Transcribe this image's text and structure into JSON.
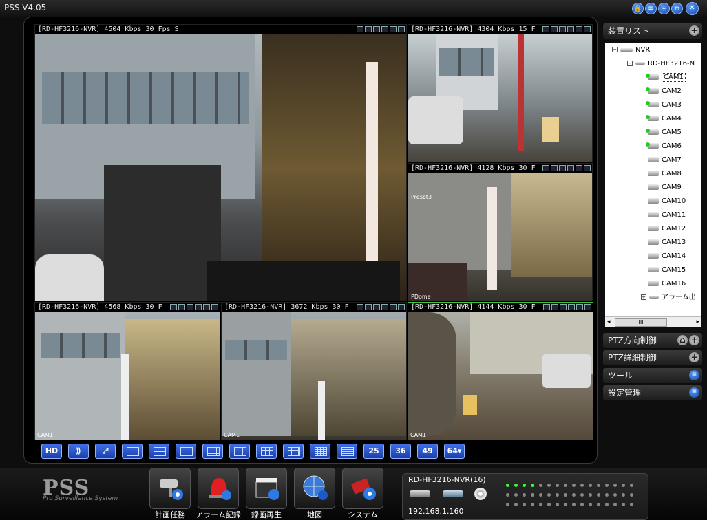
{
  "window": {
    "title": "PSS  V4.05"
  },
  "panes": [
    {
      "header": "[RD-HF3216-NVR]  4504 Kbps 30 Fps S"
    },
    {
      "header": "[RD-HF3216-NVR]  4304 Kbps 15 F"
    },
    {
      "header": "[RD-HF3216-NVR]  4128 Kbps 30 F",
      "overlays": {
        "preset": "Preset3",
        "pdome": "PDome"
      }
    },
    {
      "header": "[RD-HF3216-NVR]  4568 Kbps 30 F",
      "overlays": {
        "cam": "CAM1"
      }
    },
    {
      "header": "[RD-HF3216-NVR]  3672 Kbps 30 F",
      "overlays": {
        "cam": "CAM1"
      }
    },
    {
      "header": "[RD-HF3216-NVR]  4144 Kbps 30 F",
      "overlays": {
        "cam": "CAM1"
      }
    }
  ],
  "toolbar": {
    "hd": "HD",
    "split25": "25",
    "split36": "36",
    "split49": "49",
    "split64": "64▾"
  },
  "sidebar": {
    "device_list": "装置リスト",
    "tree": {
      "root": "NVR",
      "device": "RD-HF3216-N",
      "cameras": [
        {
          "label": "CAM1",
          "on": true
        },
        {
          "label": "CAM2",
          "on": true
        },
        {
          "label": "CAM3",
          "on": true
        },
        {
          "label": "CAM4",
          "on": true
        },
        {
          "label": "CAM5",
          "on": true
        },
        {
          "label": "CAM6",
          "on": true
        },
        {
          "label": "CAM7",
          "on": false
        },
        {
          "label": "CAM8",
          "on": false
        },
        {
          "label": "CAM9",
          "on": false
        },
        {
          "label": "CAM10",
          "on": false
        },
        {
          "label": "CAM11",
          "on": false
        },
        {
          "label": "CAM12",
          "on": false
        },
        {
          "label": "CAM13",
          "on": false
        },
        {
          "label": "CAM14",
          "on": false
        },
        {
          "label": "CAM15",
          "on": false
        },
        {
          "label": "CAM16",
          "on": false
        }
      ],
      "alarm": "アラーム出",
      "scroll_thumb": "III"
    },
    "ptz_direction": "PTZ方向制御",
    "ptz_detail": "PTZ詳細制御",
    "tools": "ツール",
    "settings": "設定管理"
  },
  "bottom": {
    "logo": "PSS",
    "logo_sub": "Pro Surveillance System",
    "buttons": [
      "計画任務",
      "アラーム記録",
      "録画再生",
      "地図",
      "システム"
    ],
    "device_name": "RD-HF3216-NVR(16)",
    "device_ip": "192.168.1.160",
    "leds_on": 4,
    "leds_total": 32
  },
  "colors": {
    "accent": "#1b3fa8",
    "active_border": "#3cc83c"
  }
}
